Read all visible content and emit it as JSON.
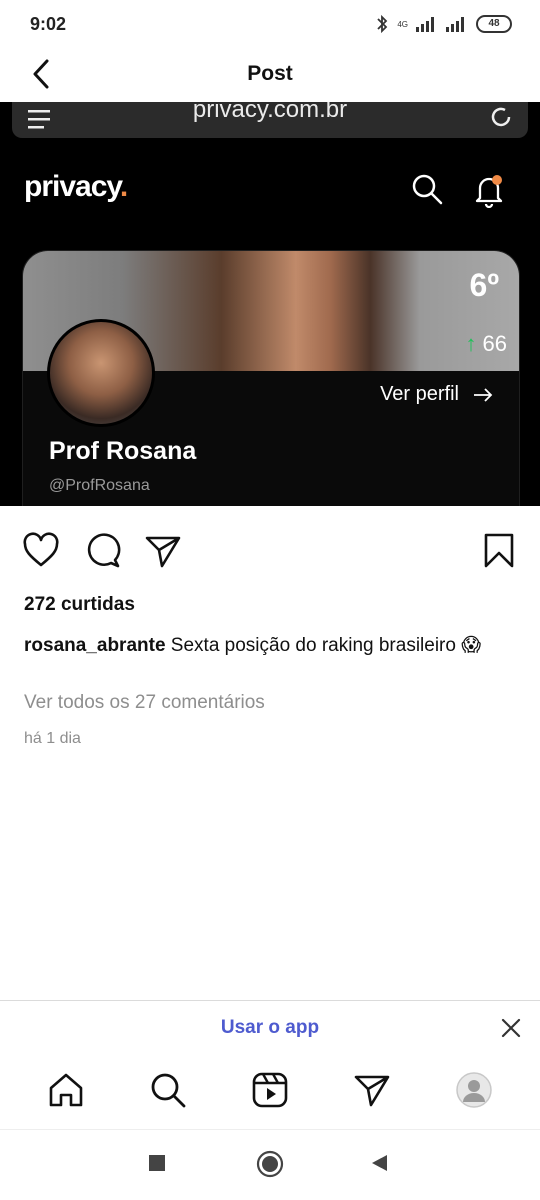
{
  "status_bar": {
    "time": "9:02",
    "battery": "48",
    "network": "4G"
  },
  "header": {
    "title": "Post"
  },
  "post_image": {
    "url": "privacy.com.br",
    "brand": "privacy",
    "brand_dot": ".",
    "rank": "6º",
    "score": "66",
    "profile_link": "Ver perfil",
    "creator_name": "Prof Rosana",
    "creator_handle": "@ProfRosana"
  },
  "post": {
    "likes": "272 curtidas",
    "username": "rosana_abrante",
    "caption": "Sexta posição do raking brasileiro",
    "emoji": "😱",
    "view_comments": "Ver todos os 27 comentários",
    "time_ago": "há 1 dia"
  },
  "banner": {
    "use_app": "Usar o app"
  },
  "colors": {
    "accent_link": "#4e5bcf",
    "brand_dot": "#f08a46",
    "up_arrow": "#21c05a"
  },
  "icons": [
    "back-icon",
    "bluetooth-icon",
    "signal-icon",
    "battery-icon",
    "menu-icon",
    "reload-icon",
    "search-icon",
    "bell-icon",
    "arrow-right-icon",
    "heart-icon",
    "comment-icon",
    "share-icon",
    "bookmark-icon",
    "close-icon",
    "home-icon",
    "reels-icon",
    "direct-icon",
    "profile-icon",
    "square-nav-icon",
    "circle-nav-icon",
    "triangle-nav-icon"
  ]
}
